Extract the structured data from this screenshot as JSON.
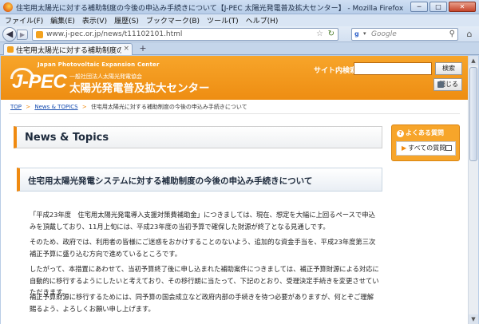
{
  "window": {
    "title": "住宅用太陽光に対する補助制度の今後の申込み手続きについて【J-PEC 太陽光発電普及拡大センター】 - Mozilla Firefox",
    "minimize": "─",
    "maximize": "□",
    "close": "✕"
  },
  "menu": [
    "ファイル(F)",
    "編集(E)",
    "表示(V)",
    "履歴(S)",
    "ブックマーク(B)",
    "ツール(T)",
    "ヘルプ(H)"
  ],
  "nav": {
    "url": "www.j-pec.or.jp/news/t11102101.html",
    "search_placeholder": "Google",
    "back": "◀",
    "forward": "▶",
    "star": "☆",
    "reload": "↻",
    "home": "⌂"
  },
  "tab": {
    "label": "住宅用太陽光に対する補助制度の今後の...",
    "close": "×",
    "new": "+"
  },
  "site": {
    "subtitle": "Japan Photovoltaic Expansion Center",
    "logo": "J-PEC",
    "association": "一般社団法人太陽光発電協会",
    "center_name": "太陽光発電普及拡大センター",
    "search_label": "サイト内検索",
    "search_button": "検索",
    "close_button": "閉じる"
  },
  "breadcrumb": {
    "top": "TOP",
    "news": "News & TOPICS",
    "current": "住宅用太陽光に対する補助制度の今後の申込み手続きについて",
    "sep": ">"
  },
  "section_title": "News & Topics",
  "sidebar": {
    "faq_title": "よくある質問",
    "faq_all": "すべての質問"
  },
  "article": {
    "title": "住宅用太陽光発電システムに対する補助制度の今後の申込み手続きについて",
    "paragraphs": [
      "「平成23年度　住宅用太陽光発電導入支援対策費補助金」につきましては、現在、想定を大幅に上回るペースで申込みを頂戴しており、11月上旬には、平成23年度の当初予算で確保した財源が終了となる見通しです。",
      "そのため、政府では、利用者の皆様にご迷惑をおかけすることのないよう、追加的な資金手当を、平成23年度第三次補正予算に盛り込む方向で進めているところです。",
      "したがって、本措置にあわせて、当初予算終了後に申し込まれた補助案件につきましては、補正予算財源による対応に自動的に移行するようにしたいと考えており、その移行期に当たって、下記のとおり、受理決定手続きを変更させていただきます。",
      "補正予算財源に移行するためには、同予算の国会成立など政府内部の手続きを待つ必要がありますが、何とぞご理解賜るよう、よろしくお願い申し上げます。"
    ]
  },
  "scrollbar": {
    "up": "▲",
    "down": "▼"
  }
}
